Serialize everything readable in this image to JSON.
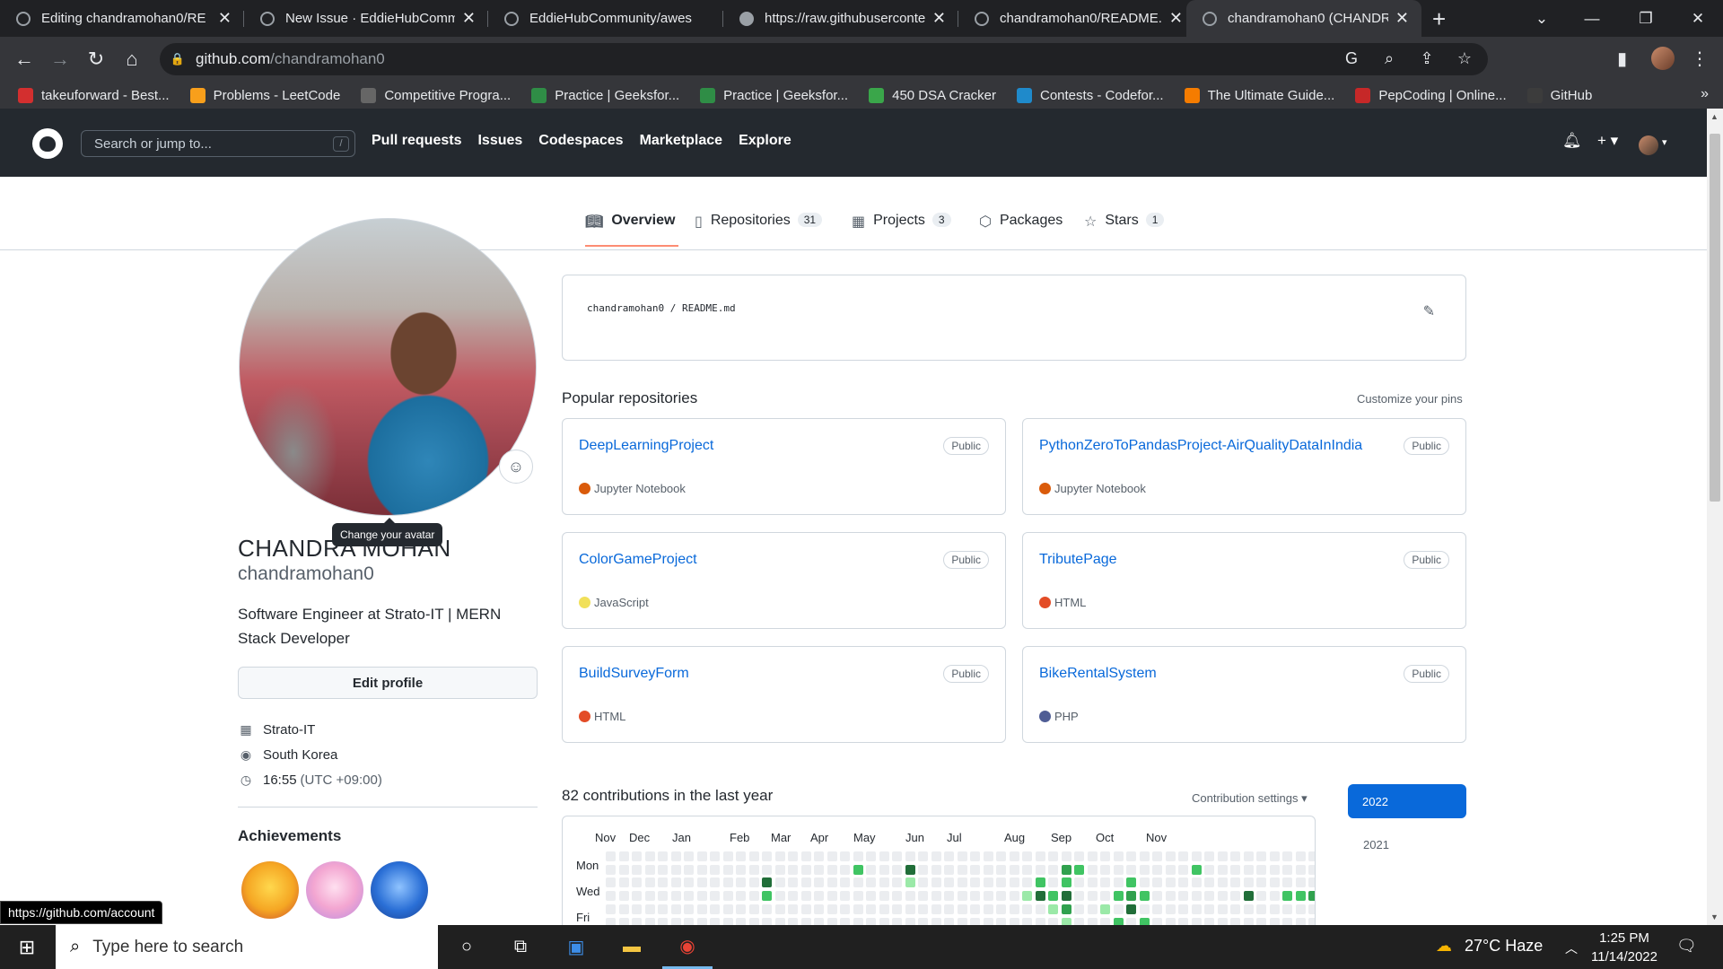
{
  "browser": {
    "tabs": [
      {
        "title": "Editing chandramohan0/RE",
        "icon": "github-icon"
      },
      {
        "title": "New Issue · EddieHubComm",
        "icon": "github-icon"
      },
      {
        "title": "EddieHubCommunity/awes",
        "icon": "github-icon"
      },
      {
        "title": "https://raw.githubuserconte",
        "icon": "globe-icon"
      },
      {
        "title": "chandramohan0/README.r",
        "icon": "github-icon"
      },
      {
        "title": "chandramohan0 (CHANDR",
        "icon": "github-icon"
      }
    ],
    "url_host": "github.com",
    "url_path": "/chandramohan0",
    "bookmarks": [
      {
        "label": "takeuforward - Best...",
        "color": "#d32f2f",
        "icon": "tuf-icon"
      },
      {
        "label": "Problems - LeetCode",
        "color": "#f89f1b",
        "icon": "leetcode-icon"
      },
      {
        "label": "Competitive Progra...",
        "color": "#666666",
        "icon": "cc-icon"
      },
      {
        "label": "Practice | Geeksfor...",
        "color": "#2f8d46",
        "icon": "gfg-icon"
      },
      {
        "label": "Practice | Geeksfor...",
        "color": "#2f8d46",
        "icon": "gfg-icon"
      },
      {
        "label": "450 DSA Cracker",
        "color": "#3aa64a",
        "icon": "dsa-icon"
      },
      {
        "label": "Contests - Codefor...",
        "color": "#1f8acb",
        "icon": "codeforces-icon"
      },
      {
        "label": "The Ultimate Guide...",
        "color": "#f57c00",
        "icon": "guide-icon"
      },
      {
        "label": "PepCoding | Online...",
        "color": "#c62828",
        "icon": "pepcoding-icon"
      },
      {
        "label": "GitHub",
        "color": "#3c3c3c",
        "icon": "github-icon"
      }
    ],
    "status_url": "https://github.com/account"
  },
  "github": {
    "search_placeholder": "Search or jump to...",
    "search_key": "/",
    "nav": [
      "Pull requests",
      "Issues",
      "Codespaces",
      "Marketplace",
      "Explore"
    ],
    "tabs": [
      {
        "label": "Overview",
        "count": "",
        "icon": "book-icon"
      },
      {
        "label": "Repositories",
        "count": "31",
        "icon": "repo-icon"
      },
      {
        "label": "Projects",
        "count": "3",
        "icon": "project-icon"
      },
      {
        "label": "Packages",
        "count": "",
        "icon": "package-icon"
      },
      {
        "label": "Stars",
        "count": "1",
        "icon": "star-icon"
      }
    ]
  },
  "profile": {
    "tooltip": "Change your avatar",
    "fullname": "CHANDRA MOHAN",
    "login": "chandramohan0",
    "bio": "Software Engineer at Strato-IT | MERN Stack Developer",
    "edit_label": "Edit profile",
    "company": "Strato-IT",
    "location": "South Korea",
    "time": "16:55",
    "timezone": "(UTC +09:00)",
    "achievements_title": "Achievements"
  },
  "readme": {
    "owner": "chandramohan0",
    "separator": " / ",
    "file": "README.md"
  },
  "popular": {
    "title": "Popular repositories",
    "customize": "Customize your pins",
    "repos": [
      {
        "name": "DeepLearningProject",
        "visibility": "Public",
        "lang": "Jupyter Notebook",
        "color": "#DA5B0B"
      },
      {
        "name": "PythonZeroToPandasProject-AirQualityDataInIndia",
        "visibility": "Public",
        "lang": "Jupyter Notebook",
        "color": "#DA5B0B"
      },
      {
        "name": "ColorGameProject",
        "visibility": "Public",
        "lang": "JavaScript",
        "color": "#f1e05a"
      },
      {
        "name": "TributePage",
        "visibility": "Public",
        "lang": "HTML",
        "color": "#e34c26"
      },
      {
        "name": "BuildSurveyForm",
        "visibility": "Public",
        "lang": "HTML",
        "color": "#e34c26"
      },
      {
        "name": "BikeRentalSystem",
        "visibility": "Public",
        "lang": "PHP",
        "color": "#4F5D95"
      }
    ]
  },
  "contributions": {
    "title": "82 contributions in the last year",
    "settings": "Contribution settings ▾",
    "months": [
      "Nov",
      "Dec",
      "Jan",
      "Feb",
      "Mar",
      "Apr",
      "May",
      "Jun",
      "Jul",
      "Aug",
      "Sep",
      "Oct",
      "Nov"
    ],
    "days": [
      "Mon",
      "Wed",
      "Fri"
    ],
    "years": [
      "2022",
      "2021"
    ],
    "colors": [
      "#ebedf0",
      "#9be9a8",
      "#40c463",
      "#30a14e",
      "#216e39"
    ]
  },
  "taskbar": {
    "search_placeholder": "Type here to search",
    "weather": "27°C  Haze",
    "time": "1:25 PM",
    "date": "11/14/2022"
  }
}
